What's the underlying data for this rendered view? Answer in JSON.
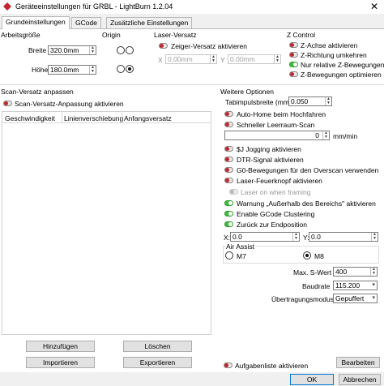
{
  "window": {
    "title": "Geräteeinstellungen für GRBL - LightBurn 1.2.04",
    "close_glyph": "✕"
  },
  "tabs": [
    {
      "label": "Grundeinstellungen",
      "active": true
    },
    {
      "label": "GCode",
      "active": false
    },
    {
      "label": "Zusätzliche Einstellungen",
      "active": false
    }
  ],
  "arbeitsgroesse": {
    "title": "Arbeitsgröße",
    "breite_label": "Breite",
    "breite_value": "320.0mm",
    "hoehe_label": "Höhe",
    "hoehe_value": "180.0mm"
  },
  "origin": {
    "title": "Origin",
    "selected": "bottom-right"
  },
  "laser_versatz": {
    "title": "Laser-Versatz",
    "toggle_label": "Zeiger-Versatz aktivieren",
    "toggle_state": "off",
    "x_label": "X",
    "x_value": "0.00mm",
    "y_label": "Y",
    "y_value": "0.00mm"
  },
  "z_control": {
    "title": "Z Control",
    "items": [
      {
        "label": "Z-Achse aktivieren",
        "state": "off"
      },
      {
        "label": "Z-Richtung umkehren",
        "state": "off"
      },
      {
        "label": "Nur relative Z-Bewegungen",
        "state": "on"
      },
      {
        "label": "Z-Bewegungen optimieren",
        "state": "off"
      }
    ]
  },
  "scan_versatz": {
    "title": "Scan-Versatz anpassen",
    "toggle_label": "Scan-Versatz-Anpassung aktivieren",
    "toggle_state": "off",
    "columns": [
      "Geschwindigkeit",
      "Linienverschiebung",
      "Anfangsversatz"
    ],
    "buttons": {
      "add": "Hinzufügen",
      "delete": "Löschen",
      "import": "Importieren",
      "export": "Exportieren"
    }
  },
  "weitere": {
    "title": "Weitere Optionen",
    "tabimpuls_label": "Tabimpulsbreite (mm)",
    "tabimpuls_value": "0.050",
    "toggles": [
      {
        "label": "Auto-Home beim Hochfahren",
        "state": "off"
      },
      {
        "label": "Schneller Leerraum-Scan",
        "state": "off"
      }
    ],
    "speed_value": "0",
    "speed_unit": "mm/min",
    "toggles2": [
      {
        "label": "$J Jogging aktivieren",
        "state": "off"
      },
      {
        "label": "DTR-Signal aktivieren",
        "state": "off"
      },
      {
        "label": "G0-Bewegungen für den Overscan verwenden",
        "state": "off"
      },
      {
        "label": "Laser-Feuerknopf aktivieren",
        "state": "off"
      },
      {
        "label": "Laser on when framing",
        "state": "disabled"
      },
      {
        "label": "Warnung „Außerhalb des Bereichs\" aktivieren",
        "state": "on"
      },
      {
        "label": "Enable GCode Clustering",
        "state": "on"
      },
      {
        "label": "Zurück zur Endposition",
        "state": "on"
      }
    ],
    "x_label": "X:",
    "x_value": "0.0",
    "y_label": "Y:",
    "y_value": "0.0",
    "air_assist": {
      "title": "Air Assist",
      "m7": "M7",
      "m8": "M8",
      "selected": "M8"
    },
    "max_s_label": "Max. S-Wert",
    "max_s_value": "400",
    "baudrate_label": "Baudrate",
    "baudrate_value": "115.200",
    "uebertragung_label": "Übertragungsmodus",
    "uebertragung_value": "Gepuffert"
  },
  "footer": {
    "aufgabenliste_label": "Aufgabenliste aktivieren",
    "aufgabenliste_state": "off",
    "bearbeiten": "Bearbeiten",
    "ok": "OK",
    "cancel": "Abbrechen"
  },
  "colors": {
    "toggle_off": "#c0262d",
    "toggle_on": "#3dba3b",
    "focus_blue": "#0078d7"
  }
}
